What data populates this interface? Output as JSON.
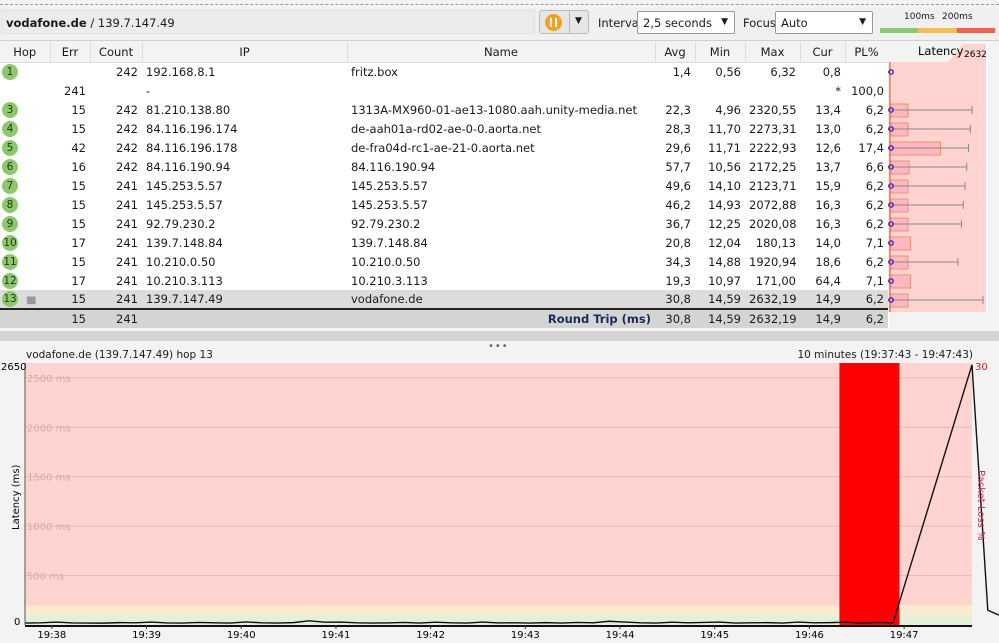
{
  "toolbar": {
    "host": "vodafone.de",
    "ip_sep": " / 139.7.147.49",
    "interval_label": "Interval",
    "interval_value": "2,5 seconds",
    "focus_label": "Focus",
    "focus_value": "Auto",
    "legend_100": "100ms",
    "legend_200": "200ms",
    "colors": {
      "green": "#8dc96c",
      "yellow": "#f9bd4f",
      "red": "#f4604a"
    }
  },
  "table": {
    "headers": [
      "Hop",
      "Err",
      "Count",
      "IP",
      "Name",
      "Avg",
      "Min",
      "Max",
      "Cur",
      "PL%",
      "Latency"
    ],
    "latency_max": "2632",
    "rows": [
      {
        "hop": "1",
        "err": "",
        "count": "242",
        "ip": "192.168.8.1",
        "name": "fritz.box",
        "avg": "1,4",
        "min": "0,56",
        "max": "6,32",
        "cur": "0,8",
        "pl": ""
      },
      {
        "hop": "",
        "err": "241",
        "count": "",
        "ip": "-",
        "name": "",
        "avg": "",
        "min": "",
        "max": "",
        "cur": "*",
        "pl": "100,0"
      },
      {
        "hop": "3",
        "err": "15",
        "count": "242",
        "ip": "81.210.138.80",
        "name": "1313A-MX960-01-ae13-1080.aah.unity-media.net",
        "avg": "22,3",
        "min": "4,96",
        "max": "2320,55",
        "cur": "13,4",
        "pl": "6,2"
      },
      {
        "hop": "4",
        "err": "15",
        "count": "242",
        "ip": "84.116.196.174",
        "name": "de-aah01a-rd02-ae-0-0.aorta.net",
        "avg": "28,3",
        "min": "11,70",
        "max": "2273,31",
        "cur": "13,0",
        "pl": "6,2"
      },
      {
        "hop": "5",
        "err": "42",
        "count": "242",
        "ip": "84.116.196.178",
        "name": "de-fra04d-rc1-ae-21-0.aorta.net",
        "avg": "29,6",
        "min": "11,71",
        "max": "2222,93",
        "cur": "12,6",
        "pl": "17,4"
      },
      {
        "hop": "6",
        "err": "16",
        "count": "242",
        "ip": "84.116.190.94",
        "name": "84.116.190.94",
        "avg": "57,7",
        "min": "10,56",
        "max": "2172,25",
        "cur": "13,7",
        "pl": "6,6"
      },
      {
        "hop": "7",
        "err": "15",
        "count": "241",
        "ip": "145.253.5.57",
        "name": "145.253.5.57",
        "avg": "49,6",
        "min": "14,10",
        "max": "2123,71",
        "cur": "15,9",
        "pl": "6,2"
      },
      {
        "hop": "8",
        "err": "15",
        "count": "241",
        "ip": "145.253.5.57",
        "name": "145.253.5.57",
        "avg": "46,2",
        "min": "14,93",
        "max": "2072,88",
        "cur": "16,3",
        "pl": "6,2"
      },
      {
        "hop": "9",
        "err": "15",
        "count": "241",
        "ip": "92.79.230.2",
        "name": "92.79.230.2",
        "avg": "36,7",
        "min": "12,25",
        "max": "2020,08",
        "cur": "16,3",
        "pl": "6,2"
      },
      {
        "hop": "10",
        "err": "17",
        "count": "241",
        "ip": "139.7.148.84",
        "name": "139.7.148.84",
        "avg": "20,8",
        "min": "12,04",
        "max": "180,13",
        "cur": "14,0",
        "pl": "7,1"
      },
      {
        "hop": "11",
        "err": "15",
        "count": "241",
        "ip": "10.210.0.50",
        "name": "10.210.0.50",
        "avg": "34,3",
        "min": "14,88",
        "max": "1920,94",
        "cur": "18,6",
        "pl": "6,2"
      },
      {
        "hop": "12",
        "err": "17",
        "count": "241",
        "ip": "10.210.3.113",
        "name": "10.210.3.113",
        "avg": "19,3",
        "min": "10,97",
        "max": "171,00",
        "cur": "64,4",
        "pl": "7,1"
      },
      {
        "hop": "13",
        "err": "15",
        "count": "241",
        "ip": "139.7.147.49",
        "name": "vodafone.de",
        "avg": "30,8",
        "min": "14,59",
        "max": "2632,19",
        "cur": "14,9",
        "pl": "6,2"
      }
    ],
    "total": {
      "err": "15",
      "count": "241",
      "label": "Round Trip (ms)",
      "avg": "30,8",
      "min": "14,59",
      "max": "2632,19",
      "cur": "14,9",
      "pl": "6,2"
    }
  },
  "chart_data": {
    "type": "line",
    "title": "vodafone.de (139.7.147.49) hop 13",
    "range": "10 minutes (19:37:43 - 19:47:43)",
    "ylabel": "Latency (ms)",
    "y2label": "Packet Loss %",
    "ylim": [
      0,
      2650
    ],
    "y2lim": [
      0,
      30
    ],
    "y_top_label": "2650",
    "y_zero_label": "0",
    "y2_top_label": "30",
    "y_grid_labels": [
      "500 ms",
      "1000 ms",
      "1500 ms",
      "2000 ms",
      "2500 ms"
    ],
    "y_grid_values": [
      500,
      1000,
      1500,
      2000,
      2500
    ],
    "x_ticks": [
      "19:38",
      "19:39",
      "19:40",
      "19:41",
      "19:42",
      "19:43",
      "19:44",
      "19:45",
      "19:46",
      "19:47"
    ],
    "bands": [
      {
        "from": 0,
        "to": 100,
        "color": "#e2f2d8"
      },
      {
        "from": 100,
        "to": 200,
        "color": "#fdebd0"
      },
      {
        "from": 200,
        "to": 2650,
        "color": "#ffd4d0"
      }
    ],
    "latency_series": {
      "start": "19:37:43",
      "step_seconds": 10,
      "values": [
        20,
        22,
        30,
        21,
        20,
        19,
        24,
        22,
        30,
        21,
        20,
        26,
        22,
        20,
        31,
        22,
        20,
        24,
        42,
        28,
        30,
        22,
        20,
        21,
        26,
        20,
        28,
        22,
        20,
        30,
        21,
        22,
        20,
        24,
        20,
        26,
        22,
        38,
        30,
        22,
        20,
        28,
        22,
        26,
        30,
        20,
        22,
        24,
        20,
        30,
        22,
        24,
        28,
        20,
        26,
        22,
        null,
        null,
        null,
        null,
        2632,
        150,
        80,
        50,
        60,
        40,
        55,
        45,
        50,
        30
      ]
    },
    "packet_loss": [
      {
        "from": "19:46:19",
        "to": "19:46:57",
        "value": 100
      }
    ],
    "loss_color": "#ff0000",
    "grid": true
  }
}
